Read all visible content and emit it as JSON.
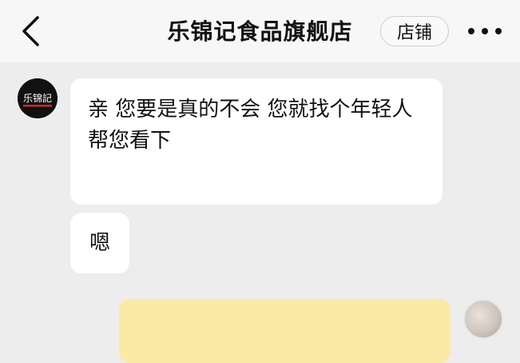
{
  "header": {
    "title": "乐锦记食品旗舰店",
    "shop_button_label": "店铺",
    "back_icon": "chevron-left-icon",
    "more_icon": "more-horizontal-icon"
  },
  "shop_avatar": {
    "logo_text": "乐锦記",
    "colors": {
      "background": "#111111",
      "stripe": "#d8262b",
      "text": "#ffffff"
    }
  },
  "messages": [
    {
      "sender": "shop",
      "text": "亲 您要是真的不会 您就找个年轻人帮您看下"
    },
    {
      "sender": "shop",
      "text": "嗯"
    },
    {
      "sender": "user",
      "text": ""
    }
  ],
  "colors": {
    "page_bg": "#ededed",
    "header_bg": "#f7f7f7",
    "incoming_bubble": "#ffffff",
    "outgoing_bubble": "#fbe9a6"
  }
}
